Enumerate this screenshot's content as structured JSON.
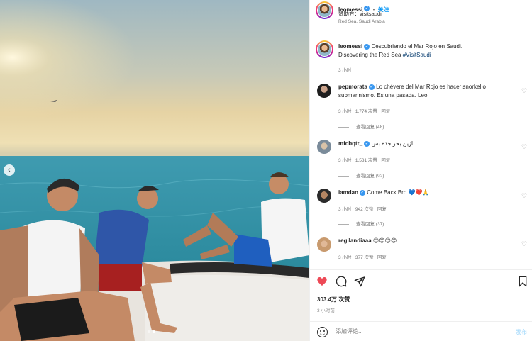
{
  "header": {
    "username": "leomessi",
    "separator": "•",
    "follow_label": "关注",
    "sponsor_prefix": "赞助方：",
    "sponsor": "visitsaudi",
    "location": "Red Sea, Saudi Arabia"
  },
  "caption": {
    "username": "leomessi",
    "text_line1": "Descubriendo el Mar Rojo en Saudi.",
    "text_line2": "Discovering the Red Sea",
    "hashtag": "#VisitSaudi",
    "time": "3 小时"
  },
  "comments": [
    {
      "username": "pepmorata",
      "verified": true,
      "text": "Lo chévere del Mar Rojo es hacer snorkel o submarinismo. Es una pasada. Leo!",
      "time": "3 小时",
      "likes": "1,774 次赞",
      "reply_label": "回复",
      "view_replies": "查看回复 (48)"
    },
    {
      "username": "mfcbqtr_",
      "verified": true,
      "text": "بازين بحر جدة بس",
      "time": "3 小时",
      "likes": "1,531 次赞",
      "reply_label": "回复",
      "view_replies": "查看回复 (92)"
    },
    {
      "username": "iamdan",
      "verified": true,
      "text": "Come Back Bro 💙❤️🙏",
      "time": "3 小时",
      "likes": "942 次赞",
      "reply_label": "回复",
      "view_replies": "查看回复 (37)"
    },
    {
      "username": "regilandiaaa",
      "verified": false,
      "text": "😍😍😍😍",
      "time": "3 小时",
      "likes": "377 次赞",
      "reply_label": "回复"
    }
  ],
  "actions": {
    "likes": "303.4万 次赞",
    "time": "3 小时前",
    "comment_placeholder": "添加评论...",
    "post_label": "发布"
  },
  "icons": [
    "chevron-left-icon",
    "heart-icon",
    "comment-icon",
    "share-icon",
    "bookmark-icon",
    "emoji-icon",
    "verified-icon"
  ],
  "colors": {
    "like_red": "#ed4956",
    "verified_blue": "#3897f0",
    "follow_blue": "#0095f6",
    "sea": "#2f93a6"
  },
  "carousel": {
    "active_index": 1,
    "count": 2
  }
}
